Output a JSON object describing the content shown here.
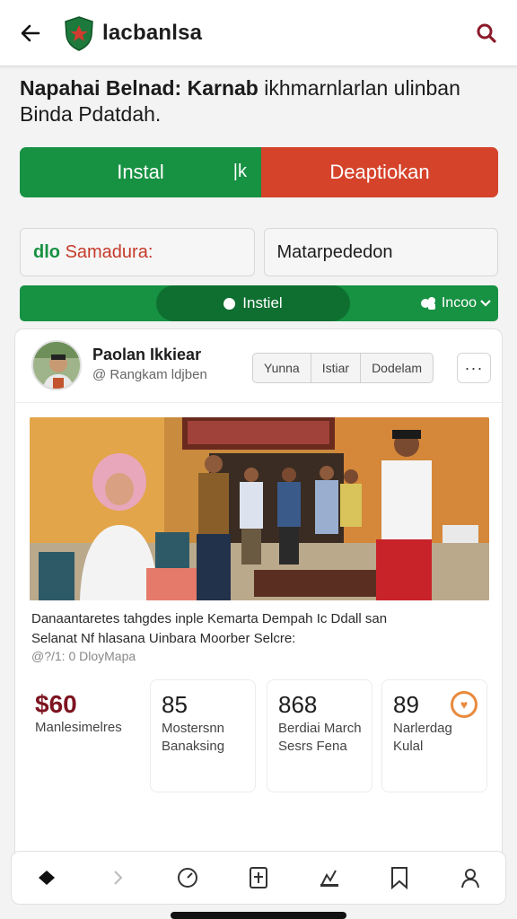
{
  "header": {
    "title": "lacbanlsa",
    "back_icon": "arrow-left-icon",
    "logo_icon": "shield-logo-icon",
    "search_icon": "search-icon",
    "brand_color": "#179142",
    "search_color": "#8b1a2b"
  },
  "headline": {
    "bold": "Napahai Belnad: Karnab",
    "rest": "ikhmarnlarlan ulinban",
    "line2": "Binda Pdatdah."
  },
  "actions": {
    "install_label": "Instal",
    "install_sep": "|k",
    "open_label": "Deaptiokan",
    "install_color": "#179142",
    "open_color": "#d5432b"
  },
  "fields": {
    "left_green": "dlo",
    "left_red": "Samadura:",
    "right_value": "Matarpededon"
  },
  "green_bar": {
    "pill_label": "Instiel",
    "right_label": "Incoo"
  },
  "post": {
    "author": "Paolan Ikkiear",
    "handle": "@ Rangkam ldjben",
    "segments": [
      "Yunna",
      "Istiar",
      "Dodelam"
    ],
    "more": "···",
    "caption_line1": "Danaantaretes tahgdes inple Kemarta Dempah Ic Ddall san",
    "caption_line2": "Selanat Nf hlasana Uinbara Moorber Selcre:",
    "meta": "@?/1: 0 DloyMapa"
  },
  "stats": [
    {
      "value": "$60",
      "label": "Manlesimelres"
    },
    {
      "value": "85",
      "label": "Mostersnn Banaksing"
    },
    {
      "value": "868",
      "label": "Berdiai March Sesrs Fena"
    },
    {
      "value": "89",
      "label": "Narlerdag Kulal",
      "badge_icon": "heart-badge-icon"
    }
  ],
  "bottom_nav": [
    "home-icon",
    "chevron-right-icon",
    "dashboard-icon",
    "plus-box-icon",
    "chart-icon",
    "bookmark-icon",
    "profile-icon"
  ]
}
